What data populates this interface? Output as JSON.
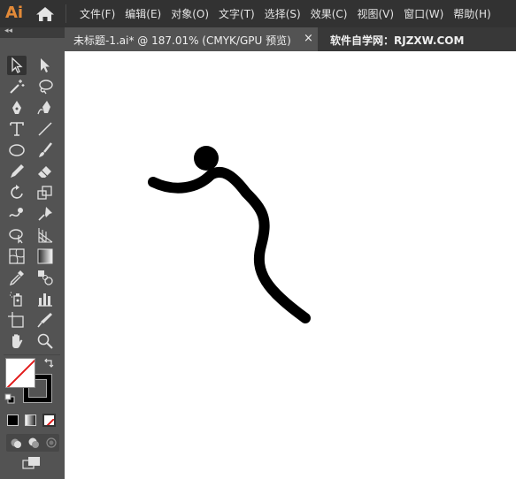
{
  "app": {
    "logo": "Ai",
    "home_icon": "home-icon"
  },
  "menu": {
    "items": [
      "文件(F)",
      "编辑(E)",
      "对象(O)",
      "文字(T)",
      "选择(S)",
      "效果(C)",
      "视图(V)",
      "窗口(W)",
      "帮助(H)"
    ]
  },
  "tabbar": {
    "document_title": "未标题-1.ai* @ 187.01% (CMYK/GPU 预览)",
    "close_glyph": "×",
    "watermark": "软件自学网：RJZXW.COM"
  },
  "toolbar": {
    "collapse_glyph": "◂◂",
    "tools": [
      "selection-tool",
      "direct-selection-tool",
      "magic-wand-tool",
      "lasso-tool",
      "pen-tool",
      "curvature-tool",
      "type-tool",
      "line-segment-tool",
      "ellipse-tool",
      "paintbrush-tool",
      "shaper-tool",
      "eraser-tool",
      "rotate-tool",
      "scale-tool",
      "warp-tool",
      "puppet-warp-tool",
      "shape-builder-tool",
      "perspective-grid-tool",
      "mesh-tool",
      "gradient-tool",
      "eyedropper-tool",
      "blend-tool",
      "symbol-sprayer-tool",
      "column-graph-tool",
      "artboard-tool",
      "slice-tool",
      "hand-tool",
      "zoom-tool"
    ],
    "selected_tool": "selection-tool"
  },
  "colors": {
    "fill": "none",
    "stroke": "#000000",
    "menubar_bg": "#323232",
    "toolbar_bg": "#535353",
    "logo_color": "#e38a38"
  }
}
